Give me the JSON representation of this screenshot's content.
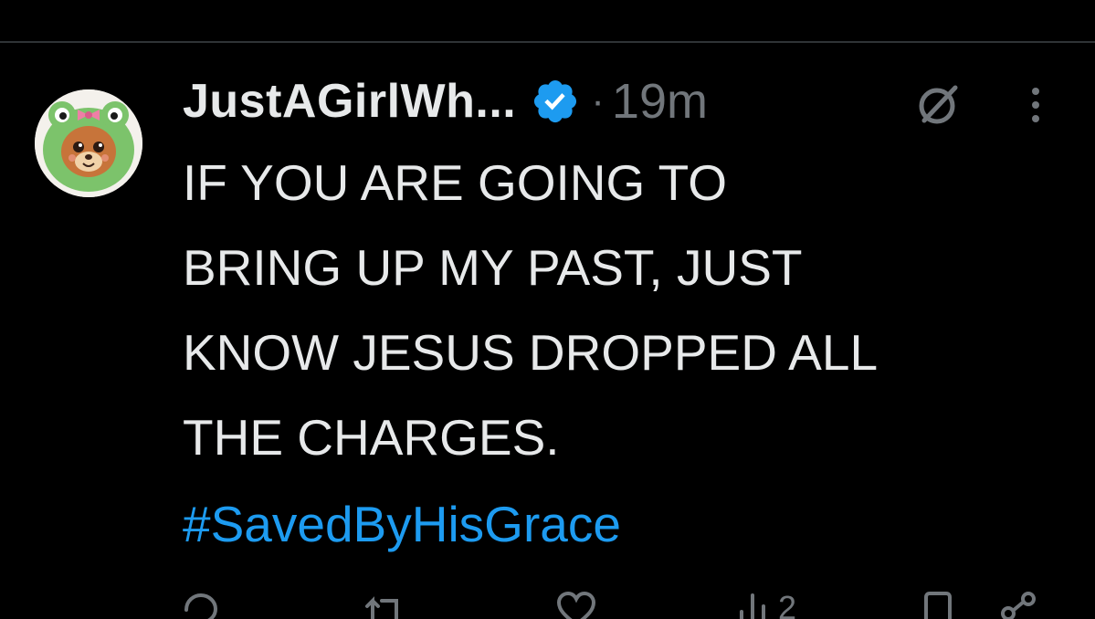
{
  "tweet": {
    "author": {
      "display_name": "JustAGirlWh...",
      "verified": true,
      "avatar_icon": "avatar-bear-frog-hood"
    },
    "separator": "·",
    "time": "19m",
    "text": "IF YOU ARE GOING TO\nBRING UP MY PAST, JUST\nKNOW JESUS DROPPED ALL\nTHE CHARGES.",
    "hashtag": "#SavedByHisGrace"
  },
  "actions": {
    "reply_icon": "reply-icon",
    "retweet_icon": "retweet-icon",
    "like_icon": "heart-icon",
    "views_icon": "views-icon",
    "views_count": "2",
    "bookmark_icon": "bookmark-icon",
    "share_icon": "share-icon"
  },
  "header_icons": {
    "grok": "grok-icon",
    "more": "more-icon"
  },
  "colors": {
    "background": "#000000",
    "text": "#e7e9ea",
    "muted": "#71767b",
    "link": "#1d9bf0",
    "verified": "#1d9bf0",
    "divider": "#2f3336"
  }
}
